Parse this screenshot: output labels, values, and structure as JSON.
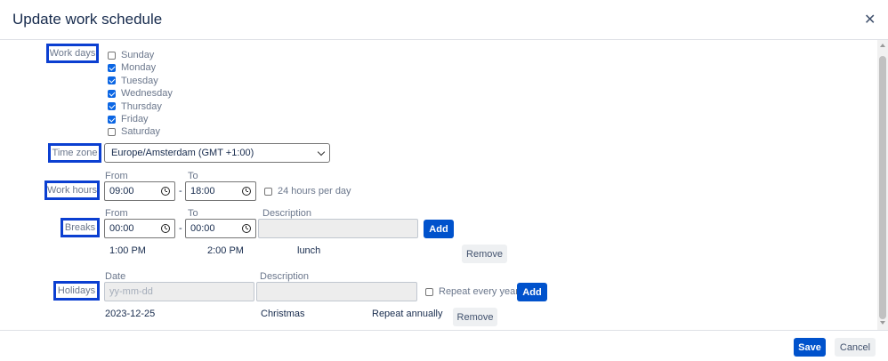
{
  "dialog": {
    "title": "Update work schedule",
    "close_icon": "close-icon"
  },
  "labels": {
    "work_days": "Work days",
    "time_zone": "Time zone",
    "work_hours": "Work hours",
    "breaks": "Breaks",
    "holidays": "Holidays"
  },
  "days": [
    {
      "label": "Sunday",
      "checked": false
    },
    {
      "label": "Monday",
      "checked": true
    },
    {
      "label": "Tuesday",
      "checked": true
    },
    {
      "label": "Wednesday",
      "checked": true
    },
    {
      "label": "Thursday",
      "checked": true
    },
    {
      "label": "Friday",
      "checked": true
    },
    {
      "label": "Saturday",
      "checked": false
    }
  ],
  "time_zone": {
    "selected": "Europe/Amsterdam (GMT +1:00)"
  },
  "work_hours": {
    "from_label": "From",
    "to_label": "To",
    "from": "09:00",
    "separator": "-",
    "to": "18:00",
    "all_day_label": "24 hours per day",
    "all_day_checked": false
  },
  "breaks": {
    "from_label": "From",
    "to_label": "To",
    "description_label": "Description",
    "from": "00:00",
    "separator": "-",
    "to": "00:00",
    "description": "",
    "add_label": "Add",
    "list": [
      {
        "from": "1:00 PM",
        "to": "2:00 PM",
        "description": "lunch",
        "remove_label": "Remove"
      }
    ]
  },
  "holidays": {
    "date_label": "Date",
    "description_label": "Description",
    "date_placeholder": "yy-mm-dd",
    "description": "",
    "repeat_label": "Repeat every year",
    "repeat_checked": false,
    "add_label": "Add",
    "list": [
      {
        "date": "2023-12-25",
        "description": "Christmas",
        "repeat": "Repeat annually",
        "remove_label": "Remove"
      }
    ]
  },
  "footer": {
    "save_label": "Save",
    "cancel_label": "Cancel"
  },
  "colors": {
    "primary": "#0052cc",
    "annotation_border": "#0b3fd1",
    "checkbox_checked": "#0b66e4"
  }
}
